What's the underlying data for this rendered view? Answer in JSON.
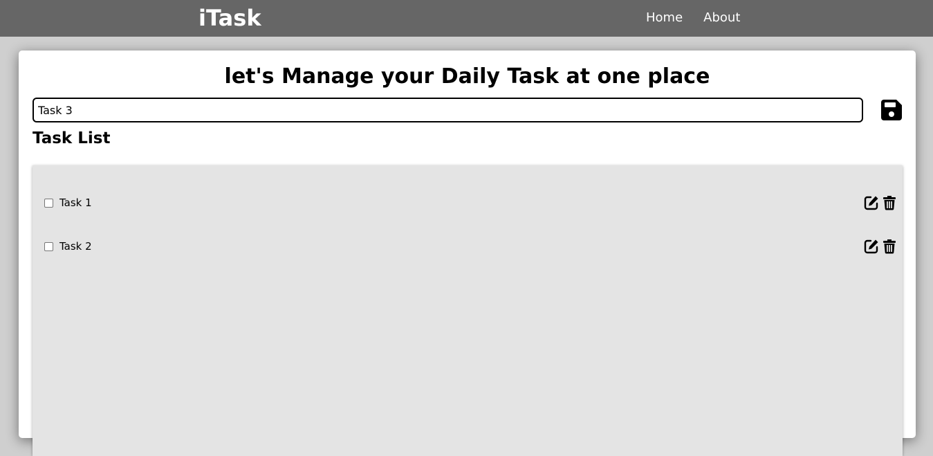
{
  "navbar": {
    "brand": "iTask",
    "links": [
      {
        "label": "Home"
      },
      {
        "label": "About"
      }
    ]
  },
  "main": {
    "heading": "let's Manage your Daily Task at one place",
    "input": {
      "value": "Task 3",
      "placeholder": ""
    },
    "save_icon": "floppy-disk-icon",
    "list_title": "Task List",
    "tasks": [
      {
        "label": "Task 1",
        "checked": false,
        "edit_icon": "edit-icon",
        "delete_icon": "trash-icon"
      },
      {
        "label": "Task 2",
        "checked": false,
        "edit_icon": "edit-icon",
        "delete_icon": "trash-icon"
      }
    ]
  },
  "colors": {
    "navbar_bg": "#666666",
    "page_bg": "#cfcfcf",
    "panel_bg": "#e4e4e4"
  }
}
